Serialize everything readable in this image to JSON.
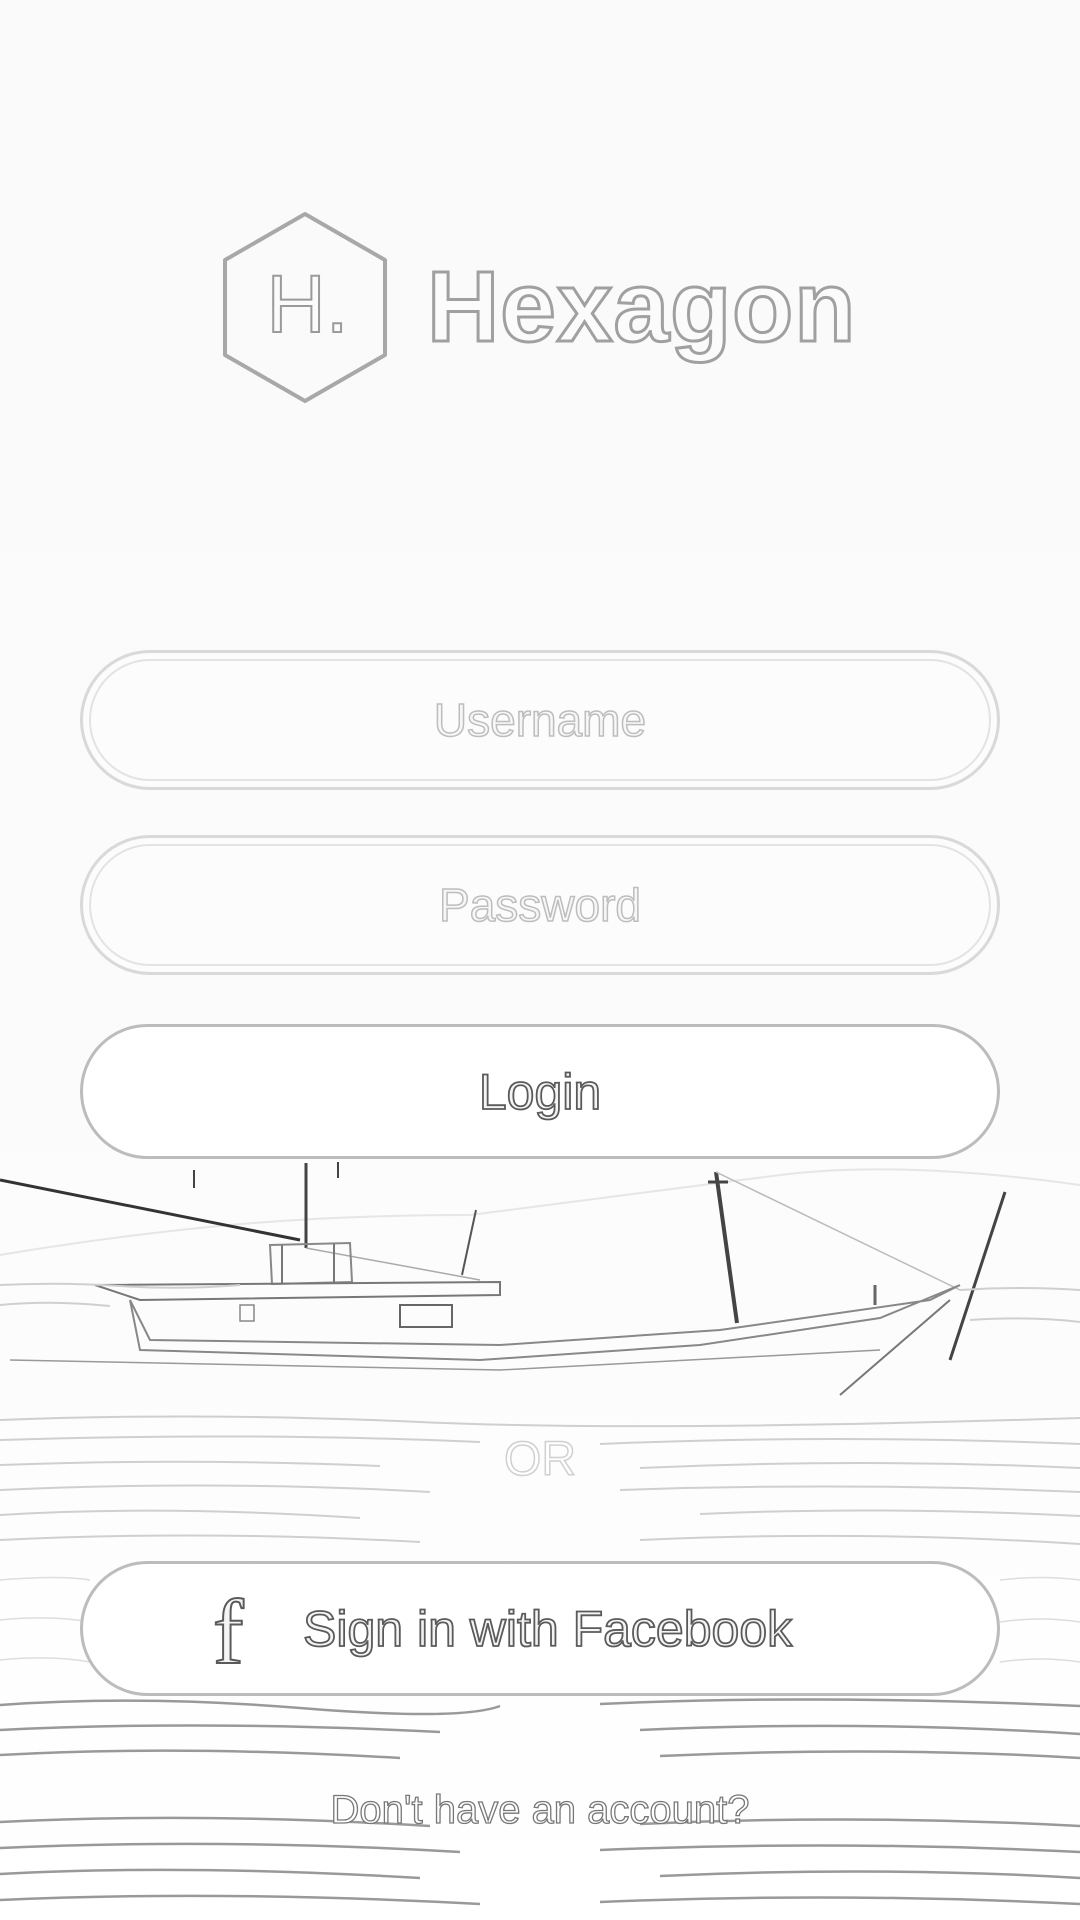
{
  "app": {
    "brand_name": "Hexagon",
    "logo_letter": "H."
  },
  "login_form": {
    "username_placeholder": "Username",
    "password_placeholder": "Password",
    "login_label": "Login",
    "or_label": "OR",
    "facebook_label": "Sign in with Facebook",
    "facebook_icon_glyph": "f",
    "signup_link_label": "Don't have an account?"
  },
  "icons": {
    "logo": "hexagon-logo-icon",
    "facebook": "facebook-icon"
  },
  "colors": {
    "background": "#fafafa",
    "outline": "#a0a0a0",
    "button_border": "#bcbcbc"
  }
}
